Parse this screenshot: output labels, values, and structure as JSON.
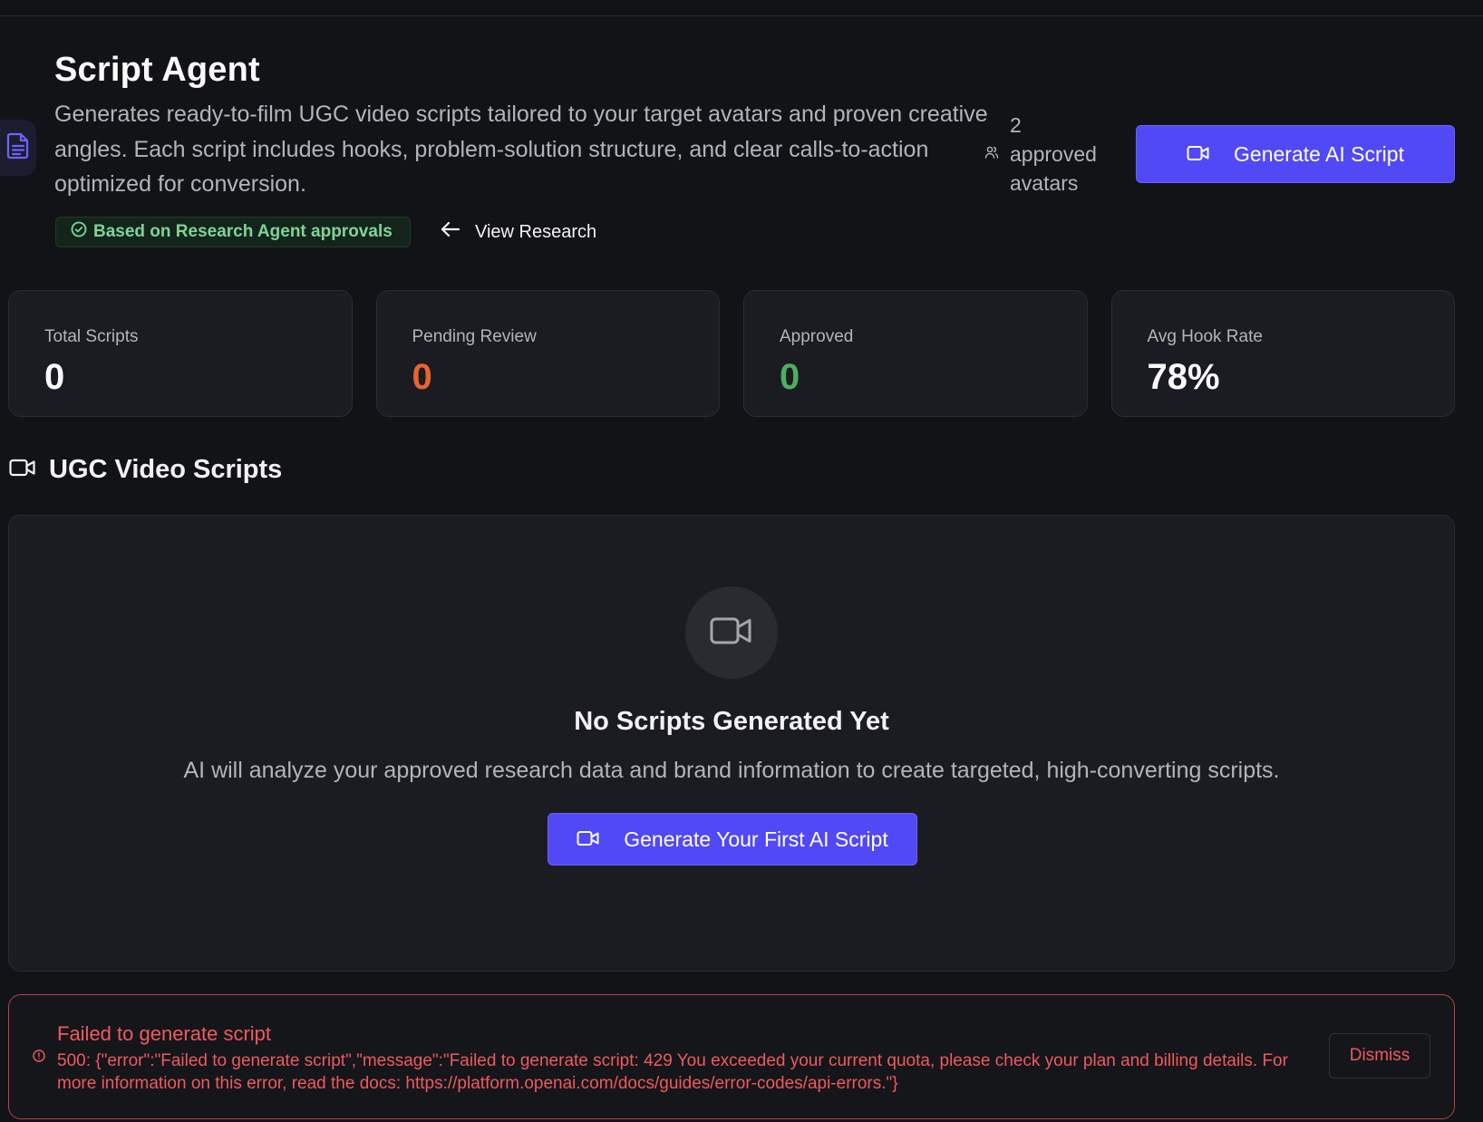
{
  "header": {
    "title": "Script Agent",
    "description": "Generates ready-to-film UGC video scripts tailored to your target avatars and proven creative angles. Each script includes hooks, problem-solution structure, and clear calls-to-action optimized for conversion.",
    "badge_label": "Based on Research Agent approvals",
    "view_research_label": "View Research",
    "avatars_count": "2",
    "avatars_label_1": "approved",
    "avatars_label_2": "avatars",
    "generate_button_label": "Generate AI Script"
  },
  "stats": [
    {
      "label": "Total Scripts",
      "value": "0",
      "color": "#fafafa"
    },
    {
      "label": "Pending Review",
      "value": "0",
      "color": "#e8642c"
    },
    {
      "label": "Approved",
      "value": "0",
      "color": "#4caf62"
    },
    {
      "label": "Avg Hook Rate",
      "value": "78%",
      "color": "#fafafa"
    }
  ],
  "section": {
    "title": "UGC Video Scripts"
  },
  "empty_state": {
    "title": "No Scripts Generated Yet",
    "description": "AI will analyze your approved research data and brand information to create targeted, high-converting scripts.",
    "button_label": "Generate Your First AI Script"
  },
  "error": {
    "title": "Failed to generate script",
    "message": "500: {\"error\":\"Failed to generate script\",\"message\":\"Failed to generate script: 429 You exceeded your current quota, please check your plan and billing details. For more information on this error, read the docs: https://platform.openai.com/docs/guides/error-codes/api-errors.\"}",
    "dismiss_label": "Dismiss"
  },
  "colors": {
    "accent": "#5149f5",
    "error": "#ee5a5f",
    "success": "#7fd49a",
    "background": "#121317",
    "card": "#1b1c21"
  },
  "icons": [
    "document-icon",
    "check-circle-icon",
    "arrow-left-icon",
    "users-icon",
    "video-camera-icon",
    "alert-circle-icon"
  ]
}
